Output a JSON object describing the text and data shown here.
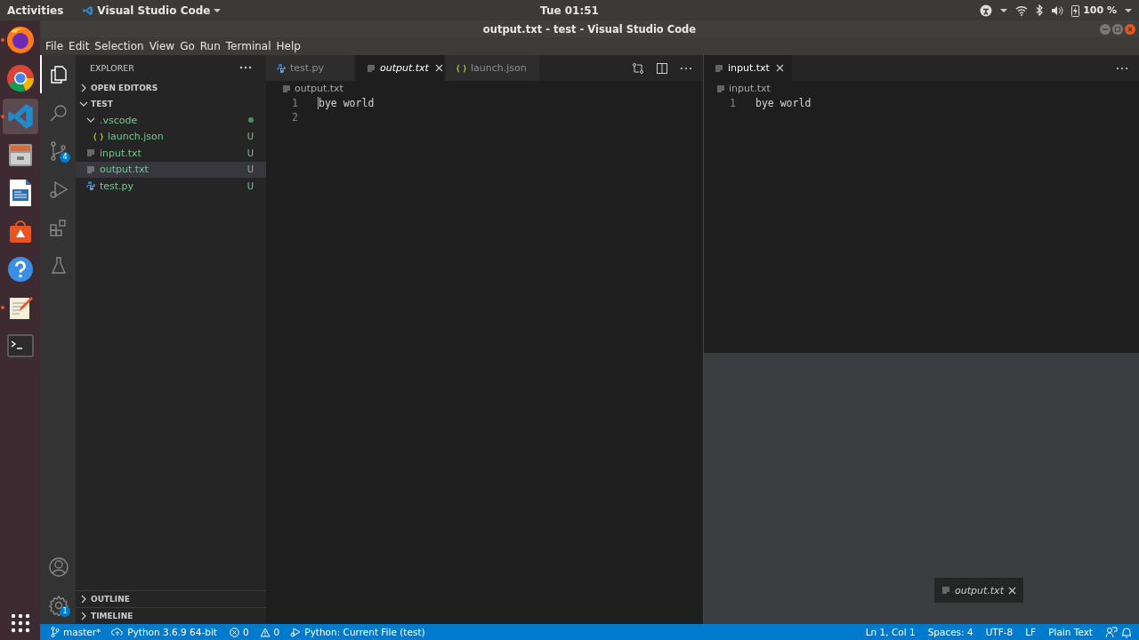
{
  "topbar": {
    "activities": "Activities",
    "app_name": "Visual Studio Code",
    "clock": "Tue 01:51",
    "battery": "100 %"
  },
  "window": {
    "title": "output.txt - test - Visual Studio Code"
  },
  "menu": [
    "File",
    "Edit",
    "Selection",
    "View",
    "Go",
    "Run",
    "Terminal",
    "Help"
  ],
  "dock": [
    {
      "kind": "firefox",
      "running": true,
      "selected": false
    },
    {
      "kind": "chrome",
      "running": false,
      "selected": false
    },
    {
      "kind": "vscode",
      "running": true,
      "selected": true
    },
    {
      "kind": "files",
      "running": false,
      "selected": false
    },
    {
      "kind": "writer",
      "running": false,
      "selected": false
    },
    {
      "kind": "software",
      "running": false,
      "selected": false
    },
    {
      "kind": "help",
      "running": false,
      "selected": false
    },
    {
      "kind": "texteditor",
      "running": true,
      "selected": false
    },
    {
      "kind": "terminal",
      "running": false,
      "selected": false
    }
  ],
  "activity_bar": [
    {
      "kind": "explorer",
      "selected": true
    },
    {
      "kind": "search",
      "selected": false
    },
    {
      "kind": "scm",
      "selected": false,
      "badge": "4"
    },
    {
      "kind": "debug",
      "selected": false
    },
    {
      "kind": "extensions",
      "selected": false
    },
    {
      "kind": "testing",
      "selected": false
    }
  ],
  "activity_bar_bottom": [
    {
      "kind": "account"
    },
    {
      "kind": "settings",
      "badge": "1"
    }
  ],
  "sidebar": {
    "title": "EXPLORER",
    "sections": [
      {
        "title": "OPEN EDITORS",
        "expanded": false
      },
      {
        "title": "TEST",
        "expanded": true,
        "tree": [
          {
            "label": ".vscode",
            "kind": "folder",
            "expanded": true,
            "status_dot": true,
            "selected": false,
            "children": [
              {
                "label": "launch.json",
                "kind": "json",
                "status": "U",
                "selected": false
              }
            ]
          },
          {
            "label": "input.txt",
            "kind": "text",
            "status": "U",
            "selected": false
          },
          {
            "label": "output.txt",
            "kind": "text",
            "status": "U",
            "selected": true
          },
          {
            "label": "test.py",
            "kind": "python",
            "status": "U",
            "selected": false
          }
        ]
      }
    ],
    "bottom_sections": [
      {
        "title": "OUTLINE",
        "expanded": false
      },
      {
        "title": "TIMELINE",
        "expanded": false
      }
    ]
  },
  "editor_groups": [
    {
      "tabs": [
        {
          "label": "test.py",
          "kind": "python",
          "selected": false,
          "preview": false
        },
        {
          "label": "output.txt",
          "kind": "text",
          "selected": true,
          "preview": true
        },
        {
          "label": "launch.json",
          "kind": "json",
          "selected": false,
          "preview": false
        }
      ],
      "actions": true,
      "breadcrumb": "output.txt",
      "lines": [
        {
          "number": "1",
          "text": "bye world"
        },
        {
          "number": "2"
        }
      ],
      "drop_target": false
    },
    {
      "tabs": [
        {
          "label": "input.txt",
          "kind": "text",
          "selected": true,
          "preview": false
        }
      ],
      "actions": false,
      "breadcrumb": "input.txt",
      "lines": [
        {
          "number": "1",
          "text": "bye world"
        }
      ],
      "drop_target": true
    }
  ],
  "drag_tab": {
    "label": "output.txt"
  },
  "status_bar": {
    "branch": "master*",
    "interpreter": "Python 3.6.9 64-bit",
    "errors": "0",
    "warnings": "0",
    "launch": "Python: Current File (test)",
    "right": [
      "Ln 1, Col 1",
      "Spaces: 4",
      "UTF-8",
      "LF",
      "Plain Text"
    ]
  }
}
